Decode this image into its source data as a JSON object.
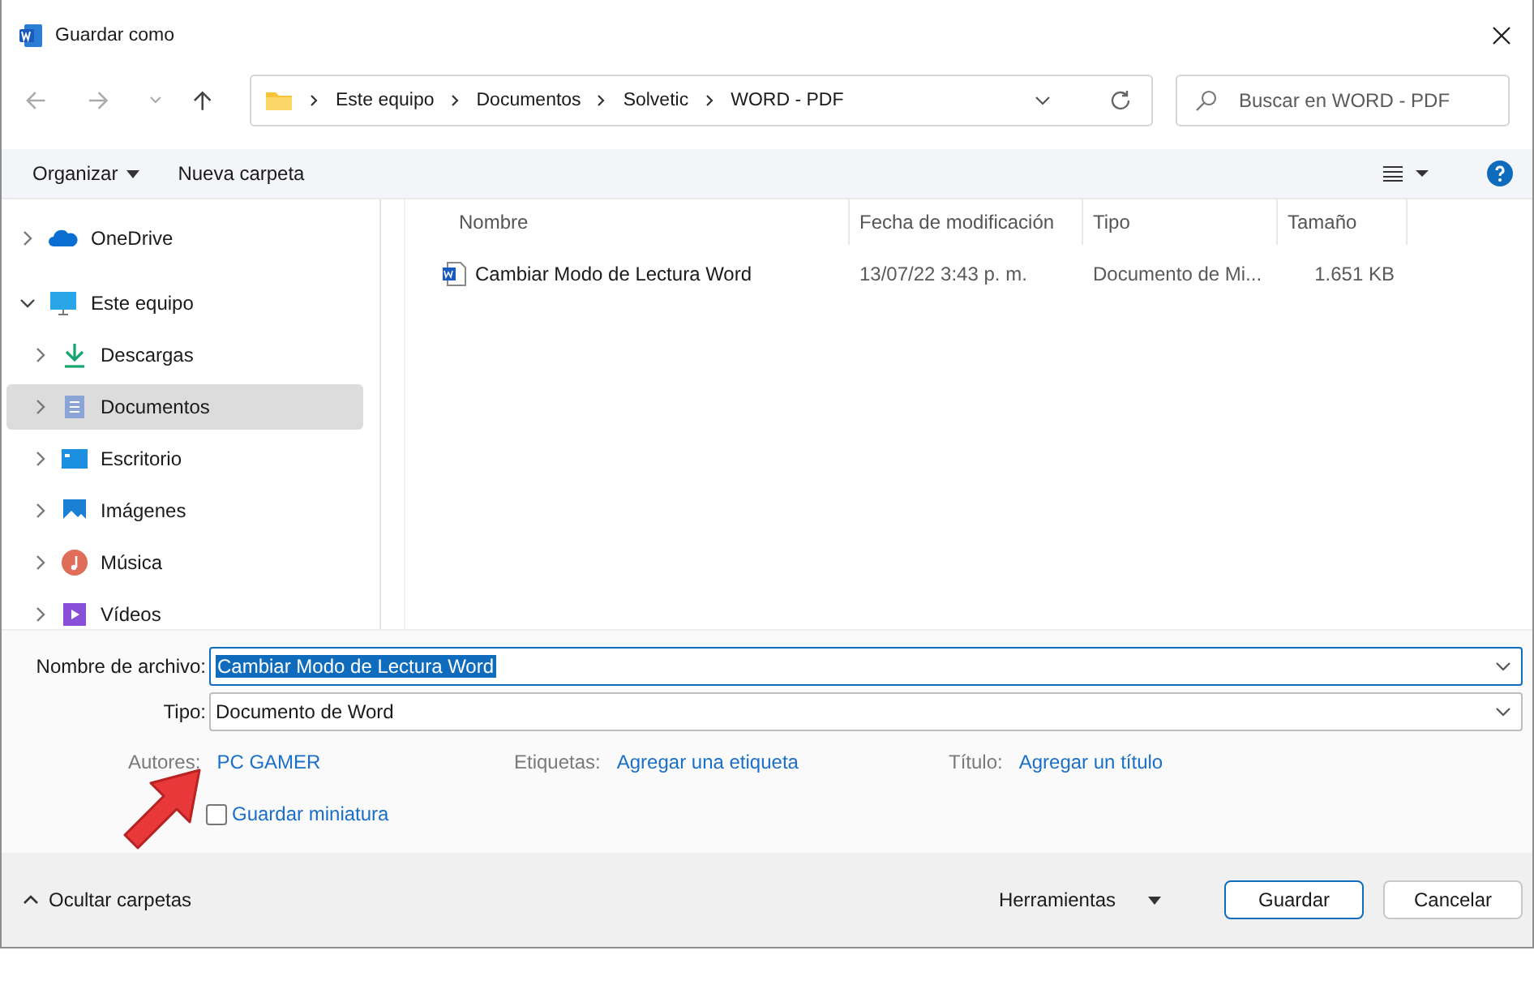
{
  "window": {
    "title": "Guardar como"
  },
  "address": {
    "crumbs": [
      "Este equipo",
      "Documentos",
      "Solvetic",
      "WORD - PDF"
    ]
  },
  "search": {
    "placeholder": "Buscar en WORD - PDF"
  },
  "toolbar": {
    "organize": "Organizar",
    "new_folder": "Nueva carpeta"
  },
  "sidebar": {
    "items": [
      {
        "label": "OneDrive",
        "kind": "cloud",
        "expanded": false,
        "selected": false
      },
      {
        "label": "Este equipo",
        "kind": "monitor",
        "expanded": true,
        "selected": false,
        "children": [
          {
            "label": "Descargas",
            "kind": "download",
            "expanded": false,
            "selected": false
          },
          {
            "label": "Documentos",
            "kind": "document",
            "expanded": false,
            "selected": true
          },
          {
            "label": "Escritorio",
            "kind": "desktop",
            "expanded": false,
            "selected": false
          },
          {
            "label": "Imágenes",
            "kind": "image",
            "expanded": false,
            "selected": false
          },
          {
            "label": "Música",
            "kind": "music",
            "expanded": false,
            "selected": false
          },
          {
            "label": "Vídeos",
            "kind": "video",
            "expanded": false,
            "selected": false
          }
        ]
      }
    ]
  },
  "table": {
    "columns": [
      "Nombre",
      "Fecha de modificación",
      "Tipo",
      "Tamaño"
    ],
    "rows": [
      {
        "name": "Cambiar Modo de Lectura Word",
        "date": "13/07/22 3:43 p. m.",
        "type": "Documento de Mi...",
        "size": "1.651 KB"
      }
    ]
  },
  "form": {
    "filename_label": "Nombre de archivo:",
    "filename": "Cambiar Modo de Lectura Word",
    "type_label": "Tipo:",
    "type": "Documento de Word",
    "meta": [
      {
        "label": "Autores:",
        "value": "PC GAMER"
      },
      {
        "label": "Etiquetas:",
        "value": "Agregar una etiqueta"
      },
      {
        "label": "Título:",
        "value": "Agregar un título"
      }
    ],
    "thumbnail": {
      "label": "Guardar miniatura",
      "checked": false
    }
  },
  "footer": {
    "hide_folders": "Ocultar carpetas",
    "tools": "Herramientas",
    "save": "Guardar",
    "cancel": "Cancelar"
  }
}
